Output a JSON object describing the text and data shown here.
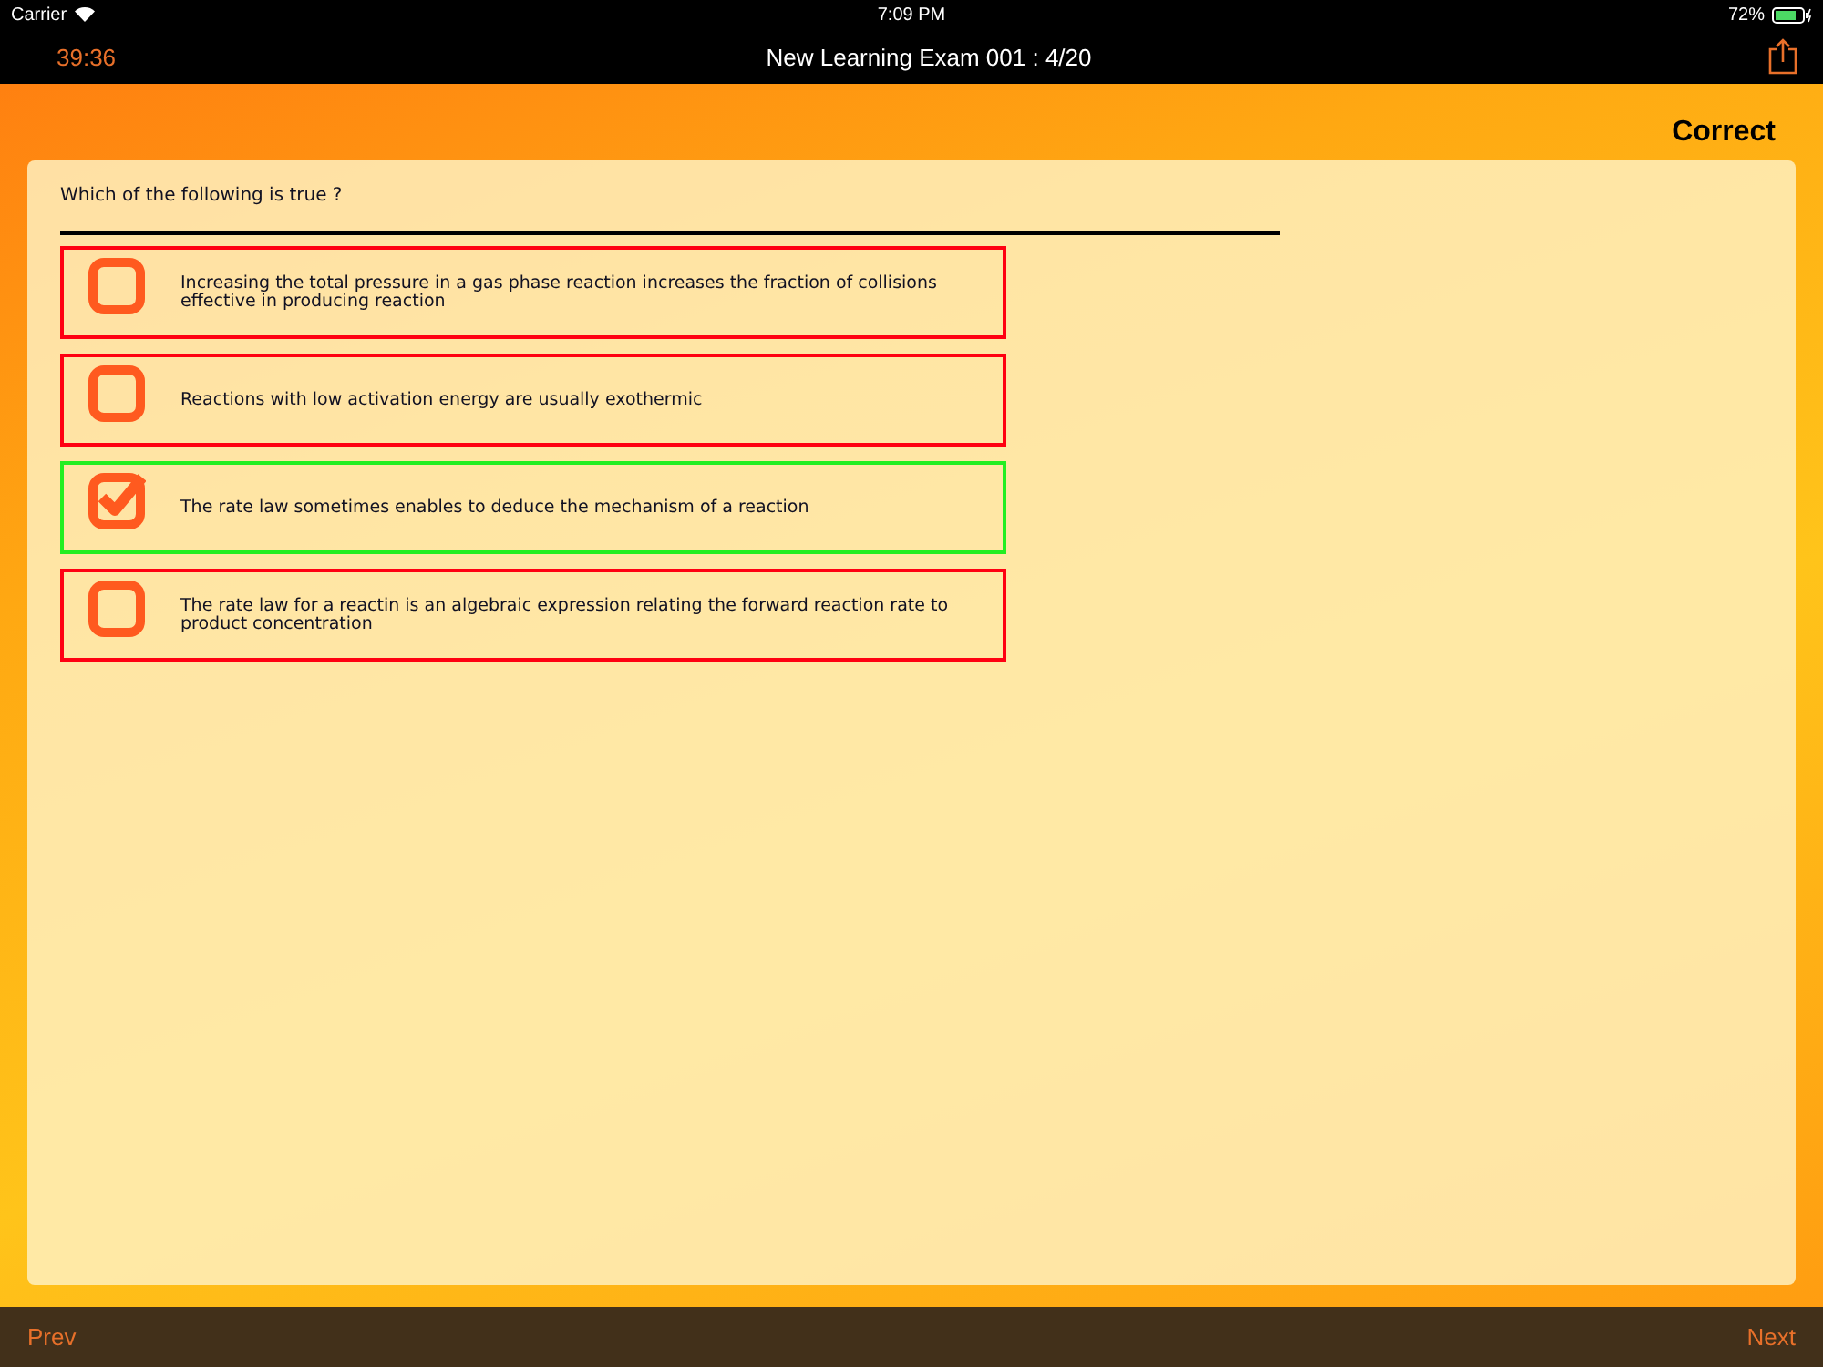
{
  "status_bar": {
    "carrier": "Carrier",
    "time": "7:09 PM",
    "battery": "72%"
  },
  "nav": {
    "timer": "39:36",
    "title": "New Learning Exam 001 : 4/20"
  },
  "result": "Correct",
  "question": "Which of the following is true ?",
  "options": [
    {
      "text": "Increasing the total pressure in a gas phase reaction increases the fraction of collisions effective in producing reaction",
      "checked": false,
      "correct": false
    },
    {
      "text": "Reactions with low activation energy are usually exothermic",
      "checked": false,
      "correct": false
    },
    {
      "text": "The rate law sometimes enables to deduce the mechanism of a reaction",
      "checked": true,
      "correct": true
    },
    {
      "text": "The rate law for a reactin is an algebraic expression relating the forward reaction rate to product concentration",
      "checked": false,
      "correct": false
    }
  ],
  "footer": {
    "prev": "Prev",
    "next": "Next"
  }
}
